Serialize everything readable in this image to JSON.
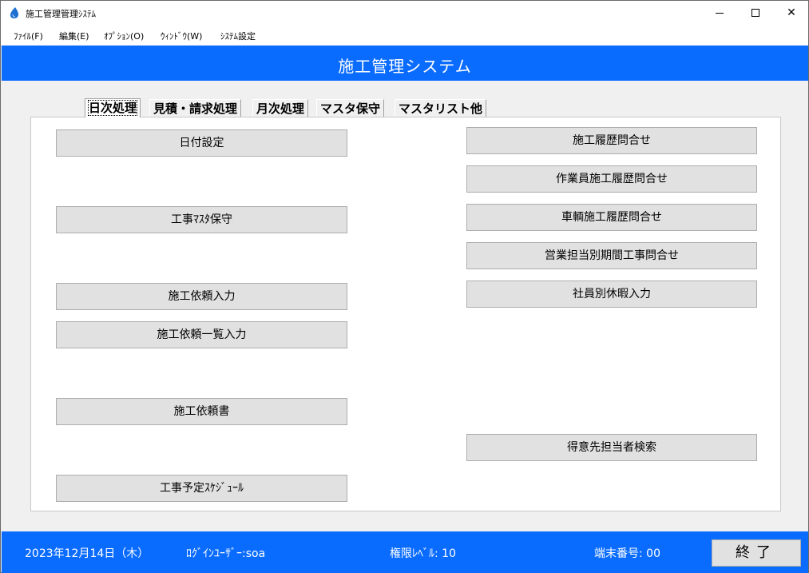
{
  "window": {
    "title": "施工管理管理ｼｽﾃﾑ",
    "minimize_icon": "minimize-icon",
    "maximize_icon": "maximize-icon",
    "close_label": "✕"
  },
  "menu": {
    "items": [
      "ﾌｧｲﾙ(F)",
      "編集(E)",
      "ｵﾌﾟｼｮﾝ(O)",
      "ｳｨﾝﾄﾞｳ(W)",
      "ｼｽﾃﾑ設定"
    ]
  },
  "header": {
    "title": "施工管理システム"
  },
  "tabs": [
    {
      "label": "日次処理",
      "active": true
    },
    {
      "label": "見積・請求処理",
      "active": false
    },
    {
      "label": "月次処理",
      "active": false
    },
    {
      "label": "マスタ保守",
      "active": false
    },
    {
      "label": "マスタリスト他",
      "active": false
    }
  ],
  "left_buttons": [
    "日付設定",
    "工事ﾏｽﾀ保守",
    "施工依頼入力",
    "施工依頼一覧入力",
    "施工依頼書",
    "工事予定ｽｹｼﾞｭｰﾙ"
  ],
  "right_buttons": [
    "施工履歴問合せ",
    "作業員施工履歴問合せ",
    "車輌施工履歴問合せ",
    "営業担当別期間工事問合せ",
    "社員別休暇入力",
    "得意先担当者検索"
  ],
  "status": {
    "date": "2023年12月14日（木）",
    "login_user": "ﾛｸﾞｲﾝﾕｰｻﾞｰ:soa",
    "permission": "権限ﾚﾍﾞﾙ: 10",
    "terminal": "端末番号:  00",
    "exit_label": "終了"
  },
  "colors": {
    "accent": "#0a6cff",
    "button_bg": "#e1e1e1"
  }
}
